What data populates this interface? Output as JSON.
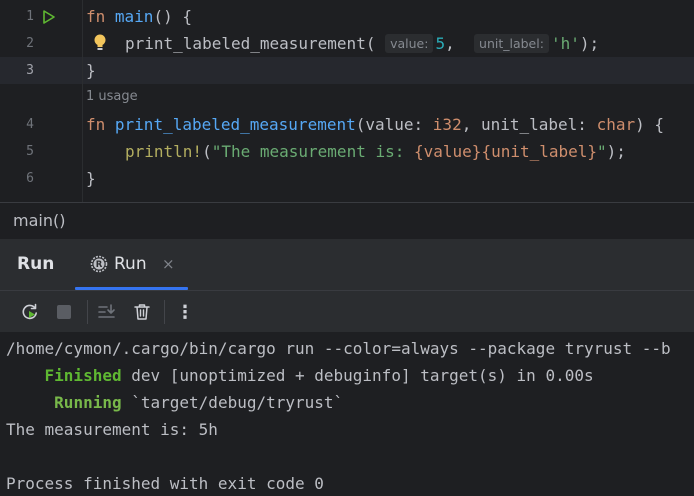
{
  "editor": {
    "line_numbers": [
      "1",
      "2",
      "3",
      "4",
      "5",
      "6"
    ],
    "line1": {
      "kw": "fn",
      "name": "main",
      "rest": "() {"
    },
    "line2": {
      "name": "print_labeled_measurement",
      "open": "(",
      "hint1": "value:",
      "arg1": "5",
      "comma": ",",
      "hint2": "unit_label:",
      "arg2": "'h'",
      "close": ");"
    },
    "line3": "}",
    "usage_hint": "1 usage",
    "line4": {
      "kw": "fn",
      "name": "print_labeled_measurement",
      "p1": "(value: ",
      "t1": "i32",
      "p2": ", unit_label: ",
      "t2": "char",
      "p3": ") {"
    },
    "line5": {
      "macro": "println!",
      "open": "(",
      "s1": "\"The measurement is: ",
      "i1": "{value}",
      "i2": "{unit_label}",
      "s2": "\"",
      "close": ");"
    },
    "line6": "}"
  },
  "breadcrumb": "main()",
  "tool_window": {
    "title": "Run",
    "tab_label": "Run",
    "tab_close": "×",
    "toolbar": {
      "rerun_icon": "rerun-icon",
      "stop_icon": "stop-icon",
      "scroll_end_icon": "scroll-to-end-icon",
      "clear_icon": "trash-icon",
      "more_icon": "more-vertical-icon",
      "more_label": "⋮"
    }
  },
  "console": {
    "command": "/home/cymon/.cargo/bin/cargo run --color=always --package tryrust --b",
    "finished_word": "Finished",
    "finished_rest": " dev [unoptimized + debuginfo] target(s) in 0.00s",
    "running_word": "Running",
    "running_rest": " `target/debug/tryrust`",
    "output": "The measurement is: 5h",
    "exit": "Process finished with exit code 0"
  },
  "colors": {
    "background": "#1e1f22",
    "panel": "#2b2d30",
    "accent": "#3574f0",
    "keyword": "#cf8e6d",
    "function": "#56a8f5",
    "string": "#6aab73",
    "success": "#5fb832"
  }
}
